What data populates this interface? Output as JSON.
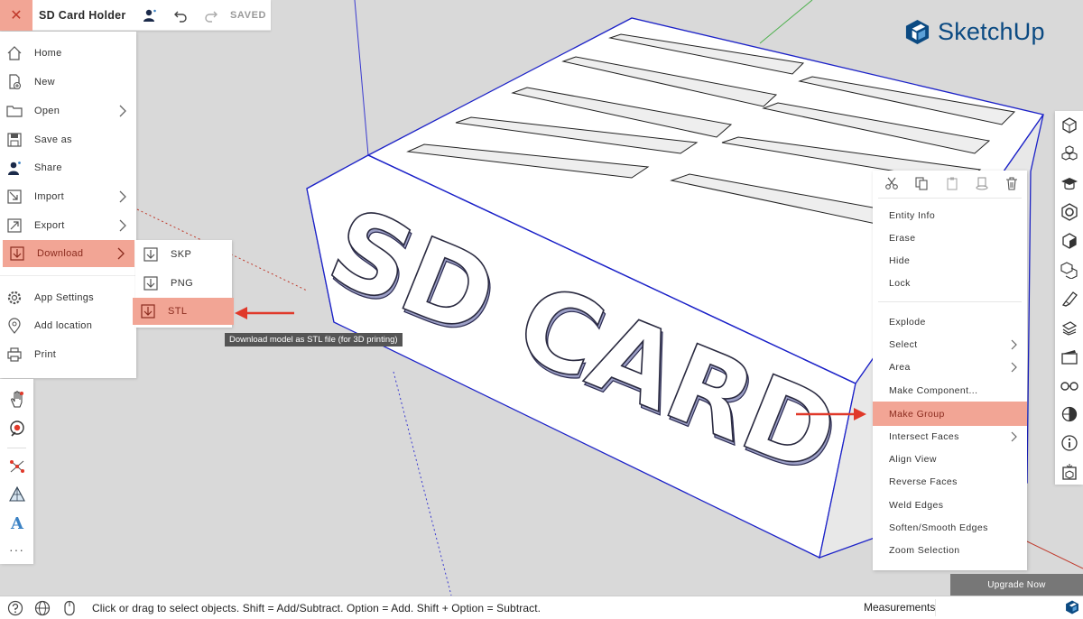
{
  "app": {
    "logo_text": "SketchUp",
    "brand_color": "#0b4a82",
    "accent_color": "#f2a595"
  },
  "header": {
    "close_icon": "close-icon",
    "title": "SD Card Holder",
    "saved_label": "SAVED"
  },
  "file_menu": {
    "items": [
      {
        "label": "Home",
        "icon": "home-icon",
        "has_submenu": false
      },
      {
        "label": "New",
        "icon": "new-file-icon",
        "has_submenu": false
      },
      {
        "label": "Open",
        "icon": "folder-icon",
        "has_submenu": true
      },
      {
        "label": "Save as",
        "icon": "save-icon",
        "has_submenu": false
      },
      {
        "label": "Share",
        "icon": "share-user-icon",
        "has_submenu": false
      },
      {
        "label": "Import",
        "icon": "import-icon",
        "has_submenu": true
      },
      {
        "label": "Export",
        "icon": "export-icon",
        "has_submenu": true
      },
      {
        "label": "Download",
        "icon": "download-icon",
        "has_submenu": true,
        "active": true
      },
      {
        "label": "App Settings",
        "icon": "gear-icon",
        "has_submenu": false
      },
      {
        "label": "Add location",
        "icon": "location-pin-icon",
        "has_submenu": false
      },
      {
        "label": "Print",
        "icon": "printer-icon",
        "has_submenu": false
      }
    ]
  },
  "download_submenu": {
    "items": [
      {
        "label": "SKP"
      },
      {
        "label": "PNG"
      },
      {
        "label": "STL",
        "active": true
      }
    ],
    "tooltip": "Download model as STL file (for 3D printing)"
  },
  "model": {
    "text": "SD CARD"
  },
  "context_menu": {
    "icons": [
      "cut-icon",
      "copy-icon",
      "paste-icon",
      "paste-in-place-icon",
      "trash-icon"
    ],
    "items": [
      {
        "label": "Entity Info",
        "has_submenu": false
      },
      {
        "label": "Erase",
        "has_submenu": false
      },
      {
        "label": "Hide",
        "has_submenu": false
      },
      {
        "label": "Lock",
        "has_submenu": false
      },
      {
        "label": "Explode",
        "has_submenu": false
      },
      {
        "label": "Select",
        "has_submenu": true
      },
      {
        "label": "Area",
        "has_submenu": true
      },
      {
        "label": "Make Component...",
        "has_submenu": false
      },
      {
        "label": "Make Group",
        "has_submenu": false,
        "active": true
      },
      {
        "label": "Intersect Faces",
        "has_submenu": true
      },
      {
        "label": "Align View",
        "has_submenu": false
      },
      {
        "label": "Reverse Faces",
        "has_submenu": false
      },
      {
        "label": "Weld Edges",
        "has_submenu": false
      },
      {
        "label": "Soften/Smooth Edges",
        "has_submenu": false
      },
      {
        "label": "Zoom Selection",
        "has_submenu": false
      }
    ]
  },
  "upgrade": {
    "label": "Upgrade Now"
  },
  "statusbar": {
    "hint": "Click or drag to select objects. Shift = Add/Subtract. Option = Add. Shift + Option = Subtract.",
    "measurements_label": "Measurements",
    "measurements_value": ""
  }
}
